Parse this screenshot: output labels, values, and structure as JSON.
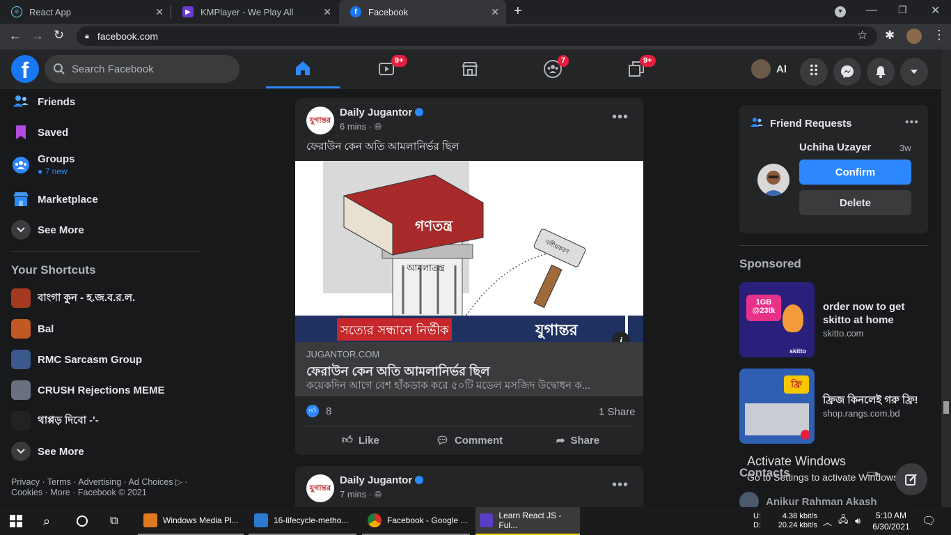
{
  "browser": {
    "tabs": [
      {
        "title": "React App",
        "icon": "react-icon",
        "active": false
      },
      {
        "title": "KMPlayer - We Play All",
        "icon": "kmplayer-icon",
        "active": false
      },
      {
        "title": "Facebook",
        "icon": "facebook-icon",
        "active": true
      }
    ],
    "new_tab_symbol": "+",
    "url": "facebook.com"
  },
  "header": {
    "search_placeholder": "Search Facebook",
    "nav": [
      {
        "name": "home",
        "badge": ""
      },
      {
        "name": "watch",
        "badge": "9+"
      },
      {
        "name": "marketplace",
        "badge": ""
      },
      {
        "name": "groups",
        "badge": "7"
      },
      {
        "name": "gaming",
        "badge": "9+"
      }
    ],
    "profile_name": "Al"
  },
  "left": {
    "items": [
      {
        "label": "Friends",
        "icon": "friends-icon"
      },
      {
        "label": "Saved",
        "icon": "bookmark-icon"
      },
      {
        "label": "Groups",
        "icon": "groups-icon",
        "sub": "7 new"
      },
      {
        "label": "Marketplace",
        "icon": "shop-icon"
      },
      {
        "label": "See More",
        "icon": "chevron-down-icon"
      }
    ],
    "shortcuts_title": "Your Shortcuts",
    "shortcuts": [
      {
        "label": "বাংগা কুন - হ.জ.ব.র.ল.",
        "color": "#a33a1f"
      },
      {
        "label": "Bal",
        "color": "#c05a22"
      },
      {
        "label": "RMC Sarcasm Group",
        "color": "#3a5a8c"
      },
      {
        "label": "CRUSH Rejections MEME",
        "color": "#6a7080"
      },
      {
        "label": "থাপ্পড় দিবো -'-",
        "color": "#222222"
      }
    ],
    "see_more2": "See More",
    "footer_line1": "Privacy · Terms · Advertising · Ad Choices ▷ ·",
    "footer_line2": "Cookies · More · Facebook © 2021"
  },
  "posts": [
    {
      "page": "Daily Jugantor",
      "time": "6 mins ·",
      "text": "ফেরাউন কেন অতি আমলানির্ভর ছিল",
      "banner": "সত্যের সন্ধানে নির্ভীক",
      "banner_logo": "যুগান্তর",
      "book_label": "গণতন্ত্র",
      "pillar_label": "আমলাতন্ত্র",
      "hammer_label": "দলীয়করণ",
      "link_domain": "JUGANTOR.COM",
      "link_title": "ফেরাউন কেন অতি আমলানির্ভর ছিল",
      "link_desc": "কয়েকদিন আগে বেশ হাঁকডাক করে ৫০টি মডেল মসজিদ উদ্বোধন ক...",
      "likes": "8",
      "shares": "1 Share",
      "actions": [
        "Like",
        "Comment",
        "Share"
      ]
    },
    {
      "page": "Daily Jugantor",
      "time": "7 mins ·"
    }
  ],
  "right": {
    "friend_requests_title": "Friend Requests",
    "request_name": "Uchiha Uzayer",
    "request_time": "3w",
    "confirm": "Confirm",
    "delete": "Delete",
    "sponsored_title": "Sponsored",
    "ads": [
      {
        "title": "order now to get skitto at home",
        "domain": "skitto.com",
        "color": "#2a1f7a",
        "img_text": "1GB @23tk",
        "img_brand": "skitto"
      },
      {
        "title": "ফ্রিজ কিনলেই গরু ফ্রি!",
        "domain": "shop.rangs.com.bd",
        "color": "#2f5fb3",
        "img_text": "ফ্রি"
      }
    ],
    "contacts_title": "Contacts",
    "contact": "Anikur Rahman Akash",
    "activate_title": "Activate Windows",
    "activate_sub": "Go to Settings to activate Windows."
  },
  "taskbar": {
    "apps": [
      {
        "label": "Windows Media Pl...",
        "color": "#e07a20"
      },
      {
        "label": "16-lifecycle-metho...",
        "color": "#2b7bd1"
      },
      {
        "label": "Facebook - Google ...",
        "color": "#e0a020"
      },
      {
        "label": "Learn React JS - Ful...",
        "color": "#5a3cc6"
      }
    ],
    "net_up_label": "U:",
    "net_up": "4.38 kbit/s",
    "net_down_label": "D:",
    "net_down": "20.24 kbit/s",
    "time": "5:10 AM",
    "date": "6/30/2021"
  }
}
